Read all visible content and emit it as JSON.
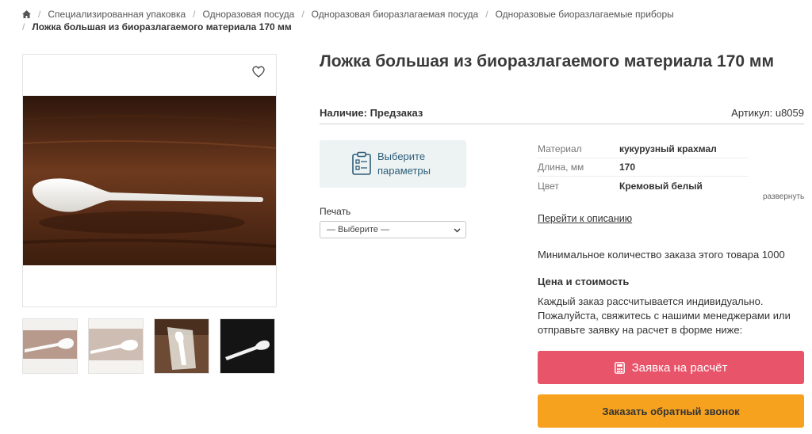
{
  "breadcrumb": {
    "home_icon": "home-icon",
    "items": [
      "Специализированная упаковка",
      "Одноразовая посуда",
      "Одноразовая биоразлагаемая посуда",
      "Одноразовые биоразлагаемые приборы"
    ],
    "current": "Ложка большая из биоразлагаемого материала 170 мм"
  },
  "product": {
    "title": "Ложка большая из биоразлагаемого материала 170 мм",
    "availability": "Наличие: Предзаказ",
    "sku": "Артикул: u8059"
  },
  "params_box": {
    "icon": "clipboard-icon",
    "label": "Выберите параметры"
  },
  "print": {
    "label": "Печать",
    "selected": "— Выберите —"
  },
  "specs": [
    {
      "key": "Материал",
      "value": "кукурузный крахмал"
    },
    {
      "key": "Длина, мм",
      "value": "170"
    },
    {
      "key": "Цвет",
      "value": "Кремовый белый"
    }
  ],
  "links": {
    "expand": "развернуть",
    "to_description": "Перейти к описанию"
  },
  "order": {
    "min_quantity": "Минимальное количество заказа этого товара 1000",
    "price_heading": "Цена и стоимость",
    "price_note": "Каждый заказ рассчитывается индивидуально. Пожалуйста, свяжитесь с нашими менеджерами или отправьте заявку на расчет в форме ниже:"
  },
  "buttons": {
    "request": "Заявка на расчёт",
    "request_icon": "calculator-icon",
    "callback": "Заказать обратный звонок"
  },
  "colors": {
    "request_button": "#e8556a",
    "callback_button": "#f7a21e",
    "params_box_bg": "#edf3f3",
    "accent_text": "#2e5d7a"
  }
}
